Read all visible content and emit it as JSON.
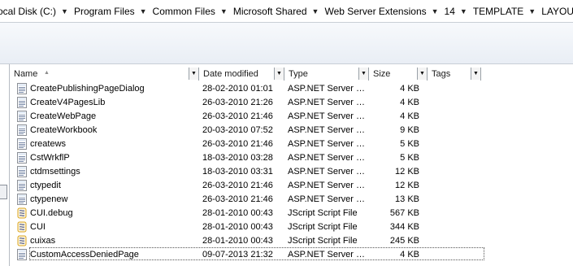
{
  "breadcrumb": [
    {
      "label": "ocal Disk (C:)"
    },
    {
      "label": "Program Files"
    },
    {
      "label": "Common Files"
    },
    {
      "label": "Microsoft Shared"
    },
    {
      "label": "Web Server Extensions"
    },
    {
      "label": "14"
    },
    {
      "label": "TEMPLATE"
    },
    {
      "label": "LAYOUTS"
    }
  ],
  "columns": {
    "name": "Name",
    "date": "Date modified",
    "type": "Type",
    "size": "Size",
    "tags": "Tags"
  },
  "files": [
    {
      "name": "CreatePublishingPageDialog",
      "date": "28-02-2010 01:01",
      "type": "ASP.NET Server …",
      "size": "4 KB",
      "icon": "aspx-file-icon"
    },
    {
      "name": "CreateV4PagesLib",
      "date": "26-03-2010 21:26",
      "type": "ASP.NET Server …",
      "size": "4 KB",
      "icon": "aspx-file-icon"
    },
    {
      "name": "CreateWebPage",
      "date": "26-03-2010 21:46",
      "type": "ASP.NET Server …",
      "size": "4 KB",
      "icon": "aspx-file-icon"
    },
    {
      "name": "CreateWorkbook",
      "date": "20-03-2010 07:52",
      "type": "ASP.NET Server …",
      "size": "9 KB",
      "icon": "aspx-file-icon"
    },
    {
      "name": "createws",
      "date": "26-03-2010 21:46",
      "type": "ASP.NET Server …",
      "size": "5 KB",
      "icon": "aspx-file-icon"
    },
    {
      "name": "CstWrkflP",
      "date": "18-03-2010 03:28",
      "type": "ASP.NET Server …",
      "size": "5 KB",
      "icon": "aspx-file-icon"
    },
    {
      "name": "ctdmsettings",
      "date": "18-03-2010 03:31",
      "type": "ASP.NET Server …",
      "size": "12 KB",
      "icon": "aspx-file-icon"
    },
    {
      "name": "ctypedit",
      "date": "26-03-2010 21:46",
      "type": "ASP.NET Server …",
      "size": "12 KB",
      "icon": "aspx-file-icon"
    },
    {
      "name": "ctypenew",
      "date": "26-03-2010 21:46",
      "type": "ASP.NET Server …",
      "size": "13 KB",
      "icon": "aspx-file-icon"
    },
    {
      "name": "CUI.debug",
      "date": "28-01-2010 00:43",
      "type": "JScript Script File",
      "size": "567 KB",
      "icon": "jscript-file-icon"
    },
    {
      "name": "CUI",
      "date": "28-01-2010 00:43",
      "type": "JScript Script File",
      "size": "344 KB",
      "icon": "jscript-file-icon"
    },
    {
      "name": "cuixas",
      "date": "28-01-2010 00:43",
      "type": "JScript Script File",
      "size": "245 KB",
      "icon": "jscript-file-icon"
    },
    {
      "name": "CustomAccessDeniedPage",
      "date": "09-07-2013 21:32",
      "type": "ASP.NET Server …",
      "size": "4 KB",
      "icon": "aspx-file-icon",
      "focused": true
    }
  ],
  "colors": {
    "aspx_icon_line": "#7a8aa8",
    "jscript_icon": "#3d4a8c",
    "scroll_gold": "#d8a320"
  }
}
